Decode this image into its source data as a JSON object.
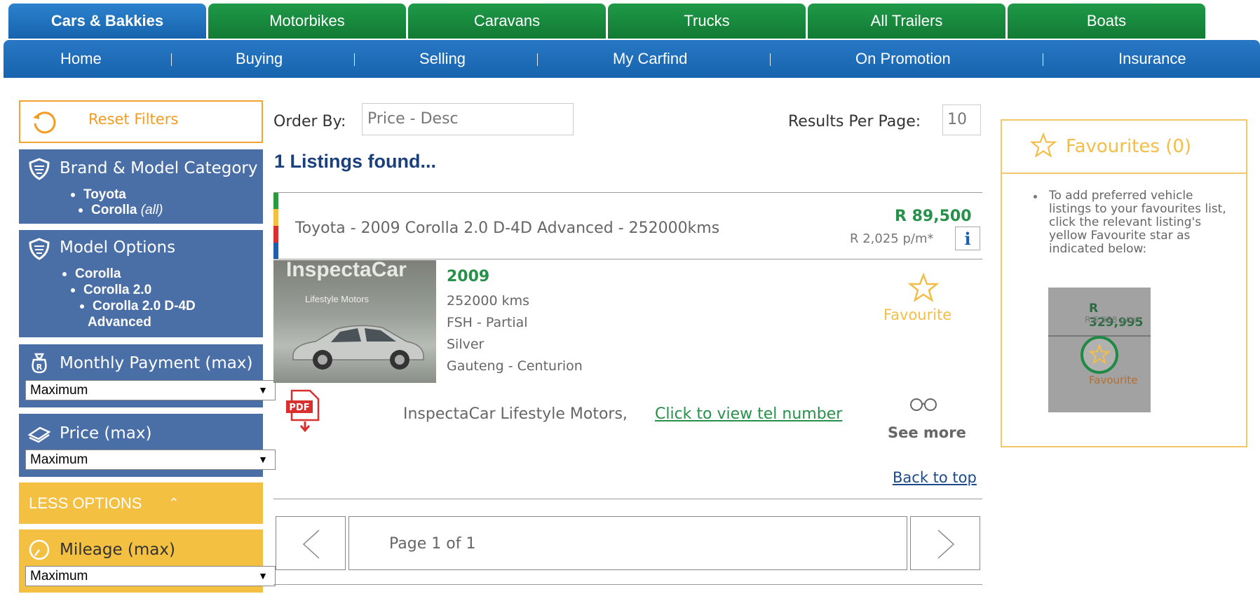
{
  "tabs": [
    "Cars & Bakkies",
    "Motorbikes",
    "Caravans",
    "Trucks",
    "All Trailers",
    "Boats"
  ],
  "nav": [
    "Home",
    "Buying",
    "Selling",
    "My Carfind",
    "On Promotion",
    "Insurance"
  ],
  "sidebar": {
    "reset": "Reset Filters",
    "brand_title": "Brand & Model Category",
    "brand_items": [
      "Toyota",
      "Corolla"
    ],
    "brand_all": "(all)",
    "model_title": "Model Options",
    "model_items": [
      "Corolla",
      "Corolla 2.0",
      "Corolla 2.0 D-4D",
      "Advanced"
    ],
    "monthly_title": "Monthly Payment (max)",
    "monthly_value": "Maximum",
    "price_title": "Price (max)",
    "price_value": "Maximum",
    "less_options": "LESS OPTIONS",
    "mileage_title": "Mileage (max)",
    "mileage_value": "Maximum"
  },
  "main": {
    "order_label": "Order By:",
    "order_value": "Price - Desc",
    "rpp_label": "Results Per Page:",
    "rpp_value": "10",
    "found": "1 Listings found...",
    "listing": {
      "title": "Toyota - 2009 Corolla 2.0 D-4D Advanced - 252000kms",
      "price": "R 89,500",
      "per_month": "R 2,025 p/m*",
      "info_label": "i",
      "photo_brand": "InspectaCar",
      "photo_sub": "Lifestyle Motors",
      "year": "2009",
      "specs": [
        "252000 kms",
        "FSH - Partial",
        "Silver",
        "Gauteng - Centurion"
      ],
      "favourite": "Favourite",
      "dealer": "InspectaCar Lifestyle Motors,",
      "tel_link": "Click to view tel number",
      "see_more": "See more",
      "back_to_top": "Back to top"
    },
    "pagination": "Page 1 of 1"
  },
  "favourites": {
    "title": "Favourites (0)",
    "text": "To add preferred vehicle listings to your favourites list, click the relevant listing's yellow Favourite star as indicated below:",
    "demo_price": "R 329,995",
    "demo_pm": "R 6,988 p/m*",
    "demo_label": "Favourite"
  },
  "colors": {
    "tab_green": "#1f9a48",
    "tab_blue": "#1f72c0",
    "sidebar_blue": "#4a6ea6",
    "accent_orange": "#f39c21",
    "price_green": "#27904a",
    "fav_yellow": "#f3be47"
  }
}
